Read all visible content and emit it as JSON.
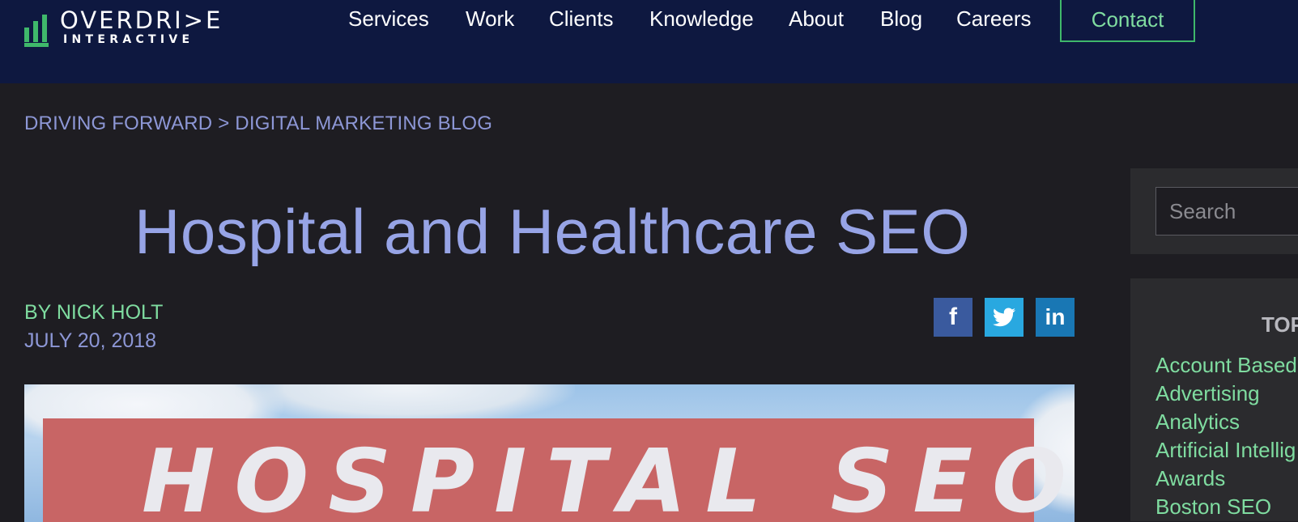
{
  "header": {
    "logo_word1": "OVERDRI>E",
    "logo_word2": "INTERACTIVE",
    "nav": [
      "Services",
      "Work",
      "Clients",
      "Knowledge",
      "About",
      "Blog",
      "Careers"
    ],
    "contact_label": "Contact"
  },
  "breadcrumb": {
    "part1": "DRIVING FORWARD",
    "separator": " > ",
    "part2": "DIGITAL MARKETING BLOG"
  },
  "article": {
    "title": "Hospital and Healthcare SEO",
    "author": "BY NICK HOLT",
    "date": "JULY 20, 2018",
    "hero_text": "HOSPITAL SEO"
  },
  "share": {
    "facebook": "f",
    "twitter": "twitter-icon",
    "linkedin": "in"
  },
  "sidebar": {
    "search_placeholder": "Search",
    "topics_heading": "TOP",
    "topics": [
      "Account Based",
      "Advertising",
      "Analytics",
      "Artificial Intellig",
      "Awards",
      "Boston SEO"
    ]
  },
  "colors": {
    "header_bg": "#0e1840",
    "page_bg": "#1e1d22",
    "accent_green": "#3fb86b",
    "link_green": "#7fdca0",
    "title_blue": "#97a4e6"
  }
}
